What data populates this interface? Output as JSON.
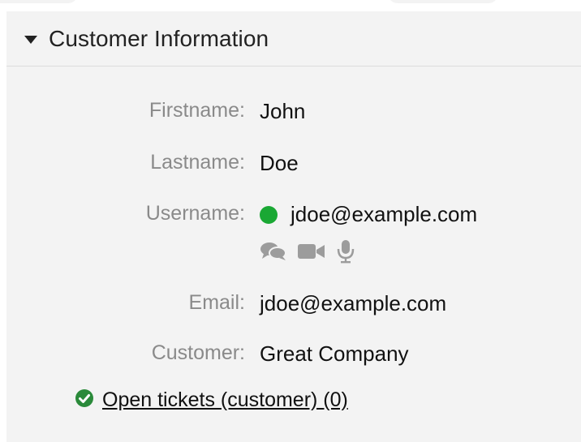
{
  "widget": {
    "title": "Customer Information"
  },
  "fields": [
    {
      "label": "Firstname:",
      "value": "John"
    },
    {
      "label": "Lastname:",
      "value": "Doe"
    },
    {
      "label": "Username:",
      "value": "jdoe@example.com"
    },
    {
      "label": "Email:",
      "value": "jdoe@example.com"
    },
    {
      "label": "Customer:",
      "value": "Great Company"
    }
  ],
  "chat_tools": {
    "icons": [
      "chat-icon",
      "video-icon",
      "microphone-icon"
    ]
  },
  "tickets_link": {
    "label": "Open tickets (customer) (0)"
  },
  "colors": {
    "status_online": "#1aa834",
    "check_green": "#2a8a3a",
    "tool_gray": "#9c9c9c"
  }
}
